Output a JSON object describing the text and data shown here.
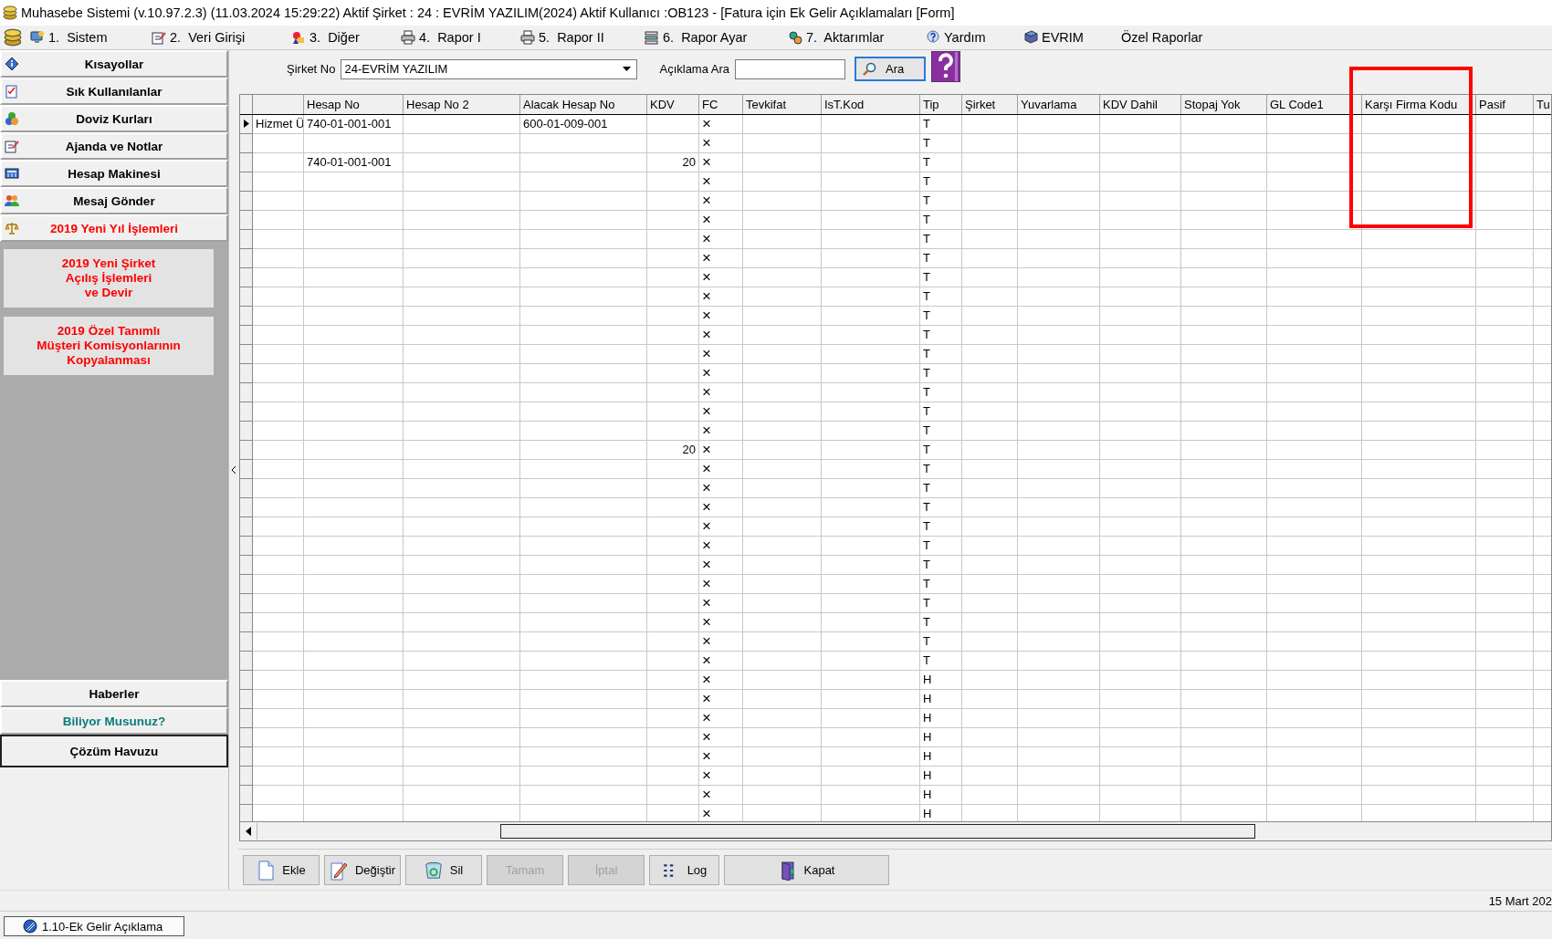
{
  "window": {
    "title": "Muhasebe Sistemi (v.10.97.2.3) (11.03.2024 15:29:22) Aktif Şirket : 24 : EVRİM YAZILIM(2024) Aktif Kullanıcı :OB123 - [Fatura için Ek Gelir Açıklamaları [Form]"
  },
  "menu": [
    {
      "label": "1.  Sistem",
      "kind": "monitor"
    },
    {
      "label": "2.  Veri Girişi",
      "kind": "notepad"
    },
    {
      "label": "3.  Diğer",
      "kind": "shapes"
    },
    {
      "label": "4.  Rapor I",
      "kind": "printer"
    },
    {
      "label": "5.  Rapor II",
      "kind": "printer"
    },
    {
      "label": "6.  Rapor Ayar",
      "kind": "papers"
    },
    {
      "label": "7.  Aktarımlar",
      "kind": "gears"
    },
    {
      "label": "Yardım",
      "kind": "help"
    },
    {
      "label": "EVRIM",
      "kind": "book"
    },
    {
      "label": "Özel Raporlar",
      "kind": "none"
    }
  ],
  "sidebar": {
    "items": [
      {
        "label": "Kısayollar",
        "kind": "info",
        "expanded": false
      },
      {
        "label": "Sık Kullanılanlar",
        "kind": "checklist",
        "expanded": false
      },
      {
        "label": "Doviz Kurları",
        "kind": "currency",
        "expanded": false
      },
      {
        "label": "Ajanda ve Notlar",
        "kind": "notepad",
        "expanded": false
      },
      {
        "label": "Hesap Makinesi",
        "kind": "calculator",
        "expanded": false
      },
      {
        "label": "Mesaj Gönder",
        "kind": "people",
        "expanded": false
      },
      {
        "label": "2019 Yeni Yıl İşlemleri",
        "kind": "scale",
        "expanded": true,
        "children": [
          {
            "label": "2019 Yeni Şirket\nAçılış İşlemleri\nve Devir"
          },
          {
            "label": "2019 Özel Tanımlı\nMüşteri Komisyonlarının\nKopyalanması"
          }
        ]
      }
    ],
    "bottom_items": [
      {
        "label": "Haberler",
        "kind": "news"
      },
      {
        "label": "Biliyor Musunuz?",
        "kind": "tips"
      },
      {
        "label": "Çözüm Havuzu",
        "kind": "solutions"
      }
    ]
  },
  "filter": {
    "company_label": "Şirket No",
    "company_value": "24-EVRİM YAZILIM",
    "search_label": "Açıklama Ara",
    "search_button": "Ara"
  },
  "table": {
    "columns": [
      null,
      "Hesap No",
      "Hesap No 2",
      "Alacak Hesap No",
      "KDV",
      "FC",
      "Tevkifat",
      "IsT.Kod",
      "Tip",
      "Şirket",
      "Yuvarlama",
      "KDV Dahil",
      "Stopaj Yok",
      "GL Code1",
      "Karşı Firma Kodu",
      "Pasif",
      "Tu"
    ],
    "rows": [
      {
        "selected": true,
        "cells": [
          "Hizmet Ü",
          "740-01-001-001",
          null,
          "600-01-009-001",
          null,
          "×",
          null,
          null,
          "T"
        ]
      },
      {
        "selected": false,
        "cells": [
          null,
          null,
          null,
          null,
          null,
          "×",
          null,
          null,
          "T"
        ]
      },
      {
        "selected": false,
        "cells": [
          null,
          "740-01-001-001",
          null,
          null,
          "20",
          "×",
          null,
          null,
          "T"
        ]
      },
      {
        "selected": false,
        "cells": [
          null,
          null,
          null,
          null,
          null,
          "×",
          null,
          null,
          "T"
        ]
      },
      {
        "selected": false,
        "cells": [
          null,
          null,
          null,
          null,
          null,
          "×",
          null,
          null,
          "T"
        ]
      },
      {
        "selected": false,
        "cells": [
          null,
          null,
          null,
          null,
          null,
          "×",
          null,
          null,
          "T"
        ]
      },
      {
        "selected": false,
        "cells": [
          null,
          null,
          null,
          null,
          null,
          "×",
          null,
          null,
          "T"
        ]
      },
      {
        "selected": false,
        "cells": [
          null,
          null,
          null,
          null,
          null,
          "×",
          null,
          null,
          "T"
        ]
      },
      {
        "selected": false,
        "cells": [
          null,
          null,
          null,
          null,
          null,
          "×",
          null,
          null,
          "T"
        ]
      },
      {
        "selected": false,
        "cells": [
          null,
          null,
          null,
          null,
          null,
          "×",
          null,
          null,
          "T"
        ]
      },
      {
        "selected": false,
        "cells": [
          null,
          null,
          null,
          null,
          null,
          "×",
          null,
          null,
          "T"
        ]
      },
      {
        "selected": false,
        "cells": [
          null,
          null,
          null,
          null,
          null,
          "×",
          null,
          null,
          "T"
        ]
      },
      {
        "selected": false,
        "cells": [
          null,
          null,
          null,
          null,
          null,
          "×",
          null,
          null,
          "T"
        ]
      },
      {
        "selected": false,
        "cells": [
          null,
          null,
          null,
          null,
          null,
          "×",
          null,
          null,
          "T"
        ]
      },
      {
        "selected": false,
        "cells": [
          null,
          null,
          null,
          null,
          null,
          "×",
          null,
          null,
          "T"
        ]
      },
      {
        "selected": false,
        "cells": [
          null,
          null,
          null,
          null,
          null,
          "×",
          null,
          null,
          "T"
        ]
      },
      {
        "selected": false,
        "cells": [
          null,
          null,
          null,
          null,
          null,
          "×",
          null,
          null,
          "T"
        ]
      },
      {
        "selected": false,
        "cells": [
          null,
          null,
          null,
          null,
          "20",
          "×",
          null,
          null,
          "T"
        ]
      },
      {
        "selected": false,
        "cells": [
          null,
          null,
          null,
          null,
          null,
          "×",
          null,
          null,
          "T"
        ]
      },
      {
        "selected": false,
        "cells": [
          null,
          null,
          null,
          null,
          null,
          "×",
          null,
          null,
          "T"
        ]
      },
      {
        "selected": false,
        "cells": [
          null,
          null,
          null,
          null,
          null,
          "×",
          null,
          null,
          "T"
        ]
      },
      {
        "selected": false,
        "cells": [
          null,
          null,
          null,
          null,
          null,
          "×",
          null,
          null,
          "T"
        ]
      },
      {
        "selected": false,
        "cells": [
          null,
          null,
          null,
          null,
          null,
          "×",
          null,
          null,
          "T"
        ]
      },
      {
        "selected": false,
        "cells": [
          null,
          null,
          null,
          null,
          null,
          "×",
          null,
          null,
          "T"
        ]
      },
      {
        "selected": false,
        "cells": [
          null,
          null,
          null,
          null,
          null,
          "×",
          null,
          null,
          "T"
        ]
      },
      {
        "selected": false,
        "cells": [
          null,
          null,
          null,
          null,
          null,
          "×",
          null,
          null,
          "T"
        ]
      },
      {
        "selected": false,
        "cells": [
          null,
          null,
          null,
          null,
          null,
          "×",
          null,
          null,
          "T"
        ]
      },
      {
        "selected": false,
        "cells": [
          null,
          null,
          null,
          null,
          null,
          "×",
          null,
          null,
          "T"
        ]
      },
      {
        "selected": false,
        "cells": [
          null,
          null,
          null,
          null,
          null,
          "×",
          null,
          null,
          "T"
        ]
      },
      {
        "selected": false,
        "cells": [
          null,
          null,
          null,
          null,
          null,
          "×",
          null,
          null,
          "H"
        ]
      },
      {
        "selected": false,
        "cells": [
          null,
          null,
          null,
          null,
          null,
          "×",
          null,
          null,
          "H"
        ]
      },
      {
        "selected": false,
        "cells": [
          null,
          null,
          null,
          null,
          null,
          "×",
          null,
          null,
          "H"
        ]
      },
      {
        "selected": false,
        "cells": [
          null,
          null,
          null,
          null,
          null,
          "×",
          null,
          null,
          "H"
        ]
      },
      {
        "selected": false,
        "cells": [
          null,
          null,
          null,
          null,
          null,
          "×",
          null,
          null,
          "H"
        ]
      },
      {
        "selected": false,
        "cells": [
          null,
          null,
          null,
          null,
          null,
          "×",
          null,
          null,
          "H"
        ]
      },
      {
        "selected": false,
        "cells": [
          null,
          null,
          null,
          null,
          null,
          "×",
          null,
          null,
          "H"
        ]
      },
      {
        "selected": false,
        "cells": [
          null,
          null,
          null,
          null,
          null,
          "×",
          null,
          null,
          "H"
        ]
      }
    ]
  },
  "buttons": [
    {
      "label": "Ekle",
      "kind": "new",
      "disabled": false
    },
    {
      "label": "Değiştir",
      "kind": "edit",
      "disabled": false
    },
    {
      "label": "Sil",
      "kind": "delete",
      "disabled": false
    },
    {
      "label": "Tamam",
      "kind": "confirm",
      "disabled": true
    },
    {
      "label": "İptal",
      "kind": "cancel",
      "disabled": true
    },
    {
      "label": "Log",
      "kind": "log",
      "disabled": false
    },
    {
      "label": "Kapat",
      "kind": "close",
      "disabled": false
    }
  ],
  "status_bar": {
    "date": "15 Mart 202"
  },
  "window_tabs": [
    {
      "label": "1.10-Ek Gelir Açıklama",
      "selected": true
    }
  ]
}
